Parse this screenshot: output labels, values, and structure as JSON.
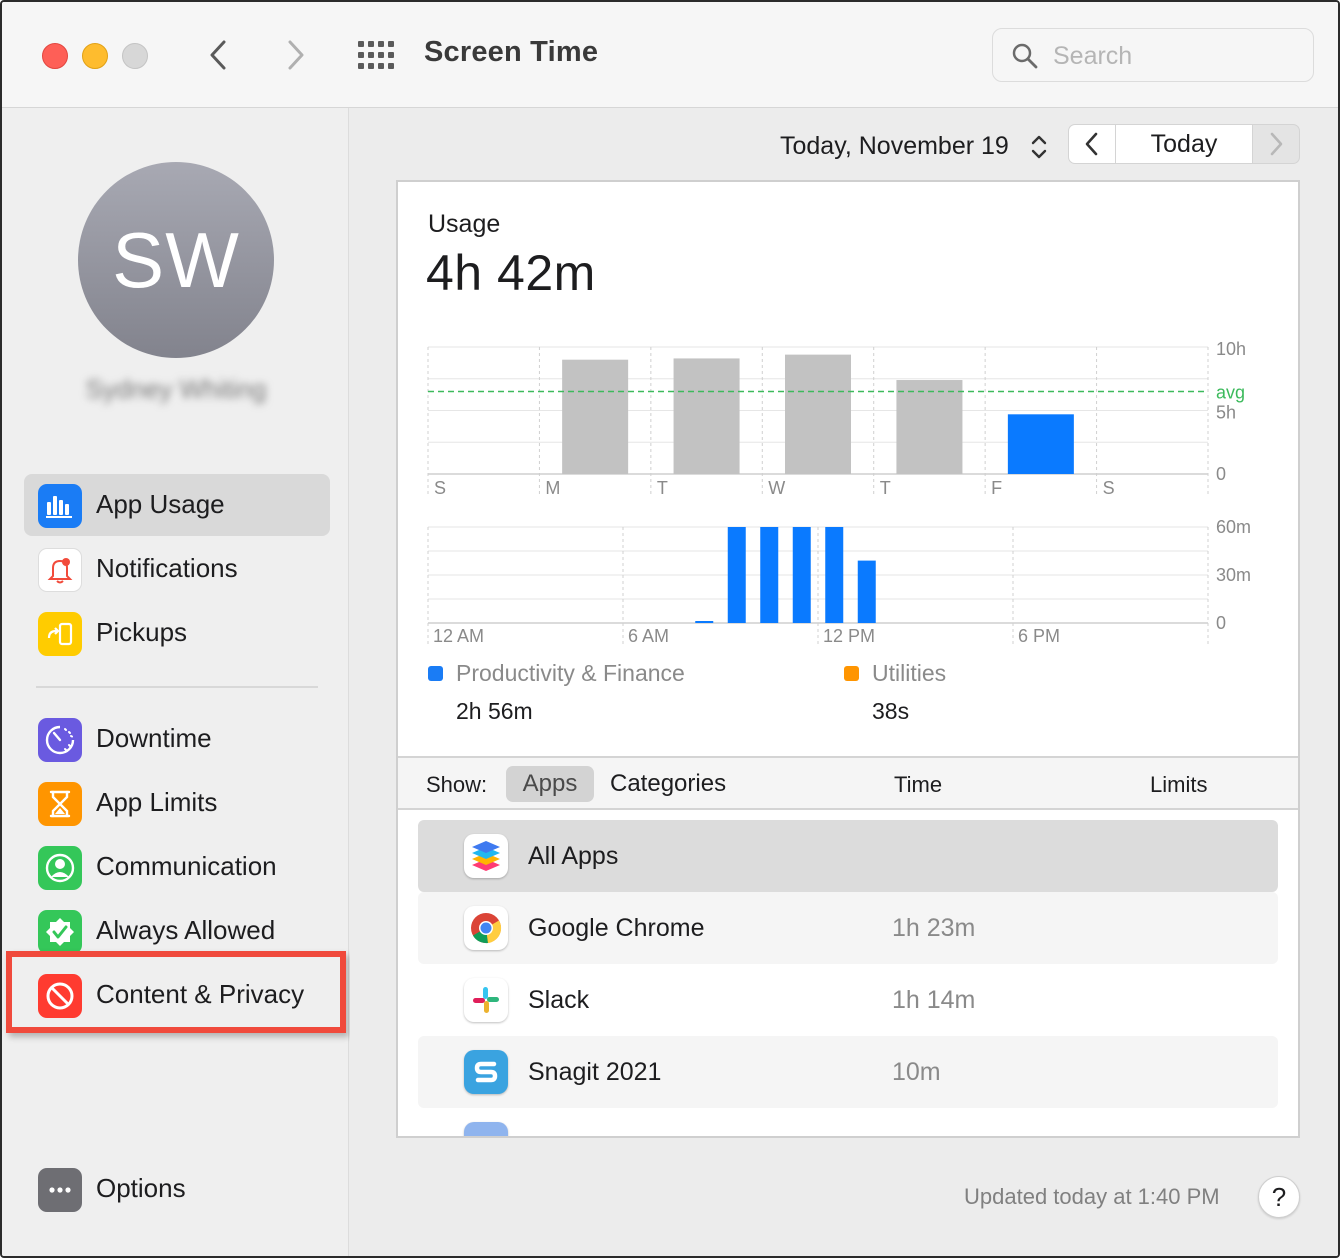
{
  "window": {
    "title": "Screen Time"
  },
  "search": {
    "placeholder": "Search"
  },
  "user": {
    "initials": "SW",
    "name": "Sydney Whiting"
  },
  "sidebar": {
    "items": [
      {
        "label": "App Usage",
        "icon": "bar-chart-icon",
        "color": "#1a7cf5",
        "active": true
      },
      {
        "label": "Notifications",
        "icon": "bell-icon",
        "color": "#f24b3b"
      },
      {
        "label": "Pickups",
        "icon": "pickup-icon",
        "color": "#ffcc00"
      },
      {
        "label": "Downtime",
        "icon": "downtime-icon",
        "color": "#6a5ae0"
      },
      {
        "label": "App Limits",
        "icon": "hourglass-icon",
        "color": "#ff9500"
      },
      {
        "label": "Communication",
        "icon": "person-icon",
        "color": "#34c759"
      },
      {
        "label": "Always Allowed",
        "icon": "checkmark-badge-icon",
        "color": "#34c759"
      },
      {
        "label": "Content & Privacy",
        "icon": "prohibited-icon",
        "color": "#ff3b30"
      }
    ],
    "options_label": "Options"
  },
  "date_nav": {
    "date_label": "Today, November 19",
    "today_label": "Today"
  },
  "usage": {
    "label": "Usage",
    "value": "4h 42m"
  },
  "chart_data": [
    {
      "type": "bar",
      "categories": [
        "S",
        "M",
        "T",
        "W",
        "T",
        "F",
        "S"
      ],
      "values": [
        0,
        9,
        9.1,
        9.4,
        7.4,
        4.7,
        0
      ],
      "highlight_index": 5,
      "average": 6.5,
      "average_label": "avg",
      "y_ticks": [
        "10h",
        "5h",
        "0"
      ],
      "ylim": [
        0,
        10
      ]
    },
    {
      "type": "bar",
      "x_labels": [
        "12 AM",
        "6 AM",
        "12 PM",
        "6 PM"
      ],
      "hours": [
        8,
        9,
        10,
        11,
        12,
        13,
        14
      ],
      "values": [
        1,
        60,
        60,
        60,
        60,
        39,
        0
      ],
      "y_ticks": [
        "60m",
        "30m",
        "0"
      ],
      "ylim": [
        0,
        60
      ]
    }
  ],
  "legend": [
    {
      "name": "Productivity & Finance",
      "value": "2h 56m",
      "color": "#1a7cf5"
    },
    {
      "name": "Utilities",
      "value": "38s",
      "color": "#ff9500"
    }
  ],
  "list": {
    "show_label": "Show:",
    "apps_label": "Apps",
    "categories_label": "Categories",
    "time_header": "Time",
    "limits_header": "Limits",
    "rows": [
      {
        "name": "All Apps",
        "time": ""
      },
      {
        "name": "Google Chrome",
        "time": "1h 23m"
      },
      {
        "name": "Slack",
        "time": "1h 14m"
      },
      {
        "name": "Snagit 2021",
        "time": "10m"
      }
    ]
  },
  "footer": {
    "updated": "Updated today at 1:40 PM",
    "help_label": "?"
  }
}
